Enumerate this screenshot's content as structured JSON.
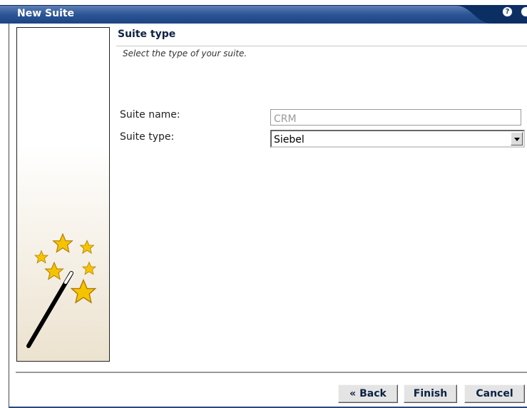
{
  "window": {
    "title": "New Suite"
  },
  "section": {
    "title": "Suite type",
    "description": "Select the type of your suite."
  },
  "form": {
    "suite_name_label": "Suite name:",
    "suite_name_value": "CRM",
    "suite_type_label": "Suite type:",
    "suite_type_value": "Siebel"
  },
  "buttons": {
    "back": "« Back",
    "finish": "Finish",
    "cancel": "Cancel"
  },
  "icons": {
    "help": "help-icon",
    "close": "close-icon",
    "wizard": "magic-wand-icon",
    "dropdown": "chevron-down-icon"
  },
  "colors": {
    "titlebar": "#0c2f63",
    "button_text": "#0c2244",
    "stars": "#f5c400"
  }
}
